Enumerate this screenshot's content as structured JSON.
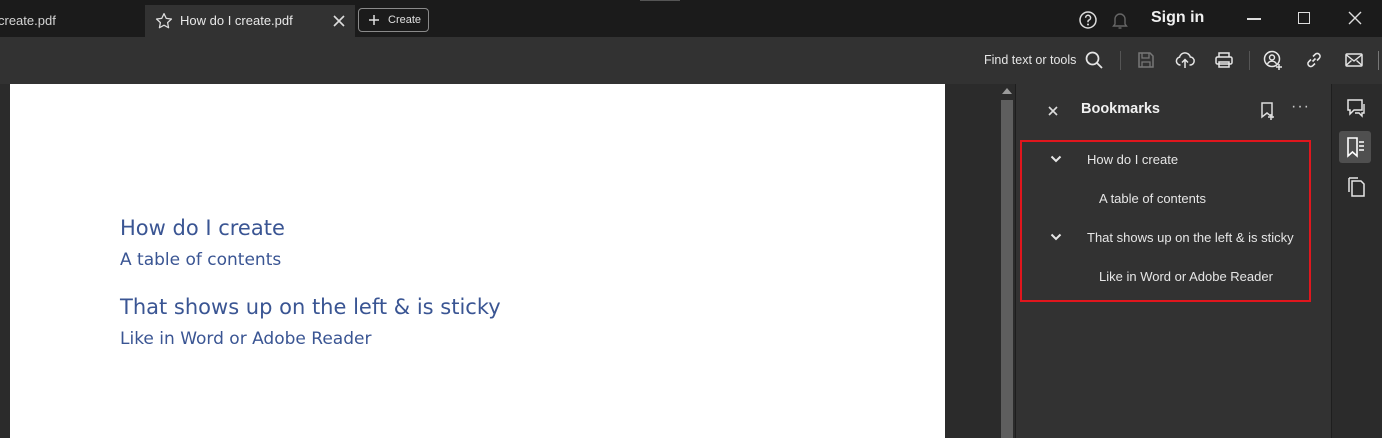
{
  "tabs": [
    {
      "label": "create.pdf",
      "active": false
    },
    {
      "label": "How do I create.pdf",
      "active": true
    }
  ],
  "create_button": {
    "label": "Create"
  },
  "header": {
    "sign_in": "Sign in"
  },
  "toolbar": {
    "find_label": "Find text or tools"
  },
  "document": {
    "heading1": "How do I create",
    "sub1": "A table of contents",
    "heading2": "That shows up on the left & is sticky",
    "sub2": "Like in Word or Adobe Reader"
  },
  "bookmarks": {
    "title": "Bookmarks",
    "more": "···",
    "items": [
      {
        "label": "How do I create",
        "level": 1,
        "expanded": true
      },
      {
        "label": "A table of contents",
        "level": 2
      },
      {
        "label": "That shows up on the left & is sticky",
        "level": 1,
        "expanded": true
      },
      {
        "label": "Like in Word or Adobe Reader",
        "level": 2
      }
    ]
  },
  "colors": {
    "doc_text": "#3a5593",
    "highlight": "#e0161d",
    "panel_bg": "#323232"
  },
  "icons": [
    "star-icon",
    "close-icon",
    "plus-icon",
    "help-icon",
    "bell-icon",
    "search-icon",
    "save-icon",
    "upload-cloud-icon",
    "print-icon",
    "share-user-icon",
    "link-icon",
    "mail-icon",
    "add-bookmark-icon",
    "comment-icon",
    "bookmark-list-icon",
    "pages-icon"
  ]
}
